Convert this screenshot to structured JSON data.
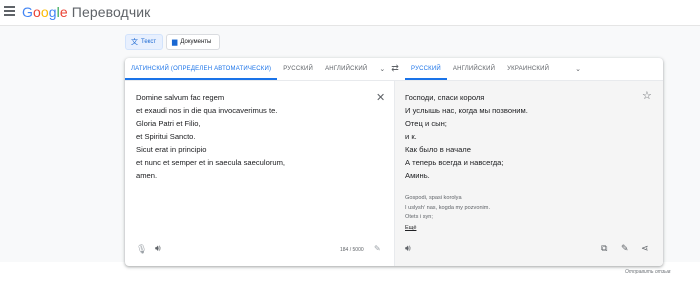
{
  "header": {
    "logo_letters": [
      "G",
      "o",
      "o",
      "g",
      "l",
      "e"
    ],
    "product_name": "Переводчик"
  },
  "modes": {
    "text_label": "Текст",
    "documents_label": "Документы"
  },
  "source_langs": {
    "detected": "ЛАТИНСКИЙ (ОПРЕДЕЛЕН АВТОМАТИЧЕСКИ)",
    "lang2": "РУССКИЙ",
    "lang3": "АНГЛИЙСКИЙ"
  },
  "target_langs": {
    "selected": "РУССКИЙ",
    "lang2": "АНГЛИЙСКИЙ",
    "lang3": "УКРАИНСКИЙ"
  },
  "source": {
    "lines": [
      "Domine salvum fac regem",
      "et exaudi nos in die qua invocaverimus te.",
      "Gloria Patri et Filio,",
      "et Spiritui Sancto.",
      "Sicut erat in principio",
      "et nunc et semper et in saecula saeculorum,",
      "amen."
    ],
    "counter": "184 / 5000"
  },
  "target": {
    "lines": [
      "Господи, спаси короля",
      "И услышь нас, когда мы позвоним.",
      "Отец и сын;",
      "и к.",
      "Как было в начале",
      "А теперь всегда и навсегда;",
      "Аминь."
    ],
    "transliteration": [
      "Gospodi, spasi korolya",
      "I uslyshʹ nas, kogda my pozvonim.",
      "Otets i syn;"
    ],
    "more_label": "Ещё"
  },
  "footer": {
    "feedback": "Отправить отзыв"
  }
}
